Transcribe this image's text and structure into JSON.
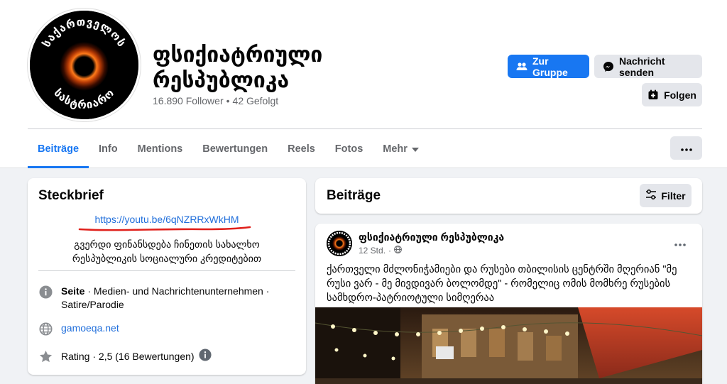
{
  "page": {
    "name": "ფსიქიატრიული რესპუბლიკა",
    "followers": "16.890 Follower",
    "separator": "•",
    "following": "42 Gefolgt"
  },
  "avatar_ring_text": "საქართველოს სასტრიარო",
  "actions": {
    "join_group": "Zur Gruppe",
    "send_message": "Nachricht senden",
    "follow": "Folgen"
  },
  "tabs": [
    {
      "label": "Beiträge",
      "active": true
    },
    {
      "label": "Info"
    },
    {
      "label": "Mentions"
    },
    {
      "label": "Bewertungen"
    },
    {
      "label": "Reels"
    },
    {
      "label": "Fotos"
    },
    {
      "label": "Mehr"
    }
  ],
  "intro": {
    "title": "Steckbrief",
    "link": "https://youtu.be/6qNZRRxWkHM",
    "bio": "გვერდი ფინანსდება ჩინეთის სახალხო რესპუბლიკის სოციალური კრედიტებით",
    "category_label": "Seite",
    "category_value": " · Medien- und Nachrichtenunternehmen · Satire/Parodie",
    "website": "gamoeqa.net",
    "rating": "Rating · 2,5 (16 Bewertungen)"
  },
  "posts": {
    "title": "Beiträge",
    "filter_label": "Filter"
  },
  "post": {
    "author": "ფსიქიატრიული რესპუბლიკა",
    "time": "12 Std.",
    "dot": "·",
    "text": "ქართველი მძლონიჭამიები და რუსები თბილისის ცენტრში მღერიან \"მე რუსი ვარ - მე მივდივარ ბოლომდე\" - რომელიც ომის მომხრე რუსების სამხდრო-პატრიოტული სიმღერაა"
  },
  "colors": {
    "brand_blue": "#1877f2",
    "link_blue": "#216fdb",
    "button_grey": "#e4e6eb",
    "page_bg": "#f0f2f5",
    "annotation_red": "#e0201b"
  },
  "icons": [
    "people-icon",
    "messenger-icon",
    "follow-plus-icon",
    "caret-down-icon",
    "ellipsis-icon",
    "filter-sliders-icon",
    "info-circle-icon",
    "globe-icon",
    "star-icon",
    "public-globe-icon"
  ]
}
